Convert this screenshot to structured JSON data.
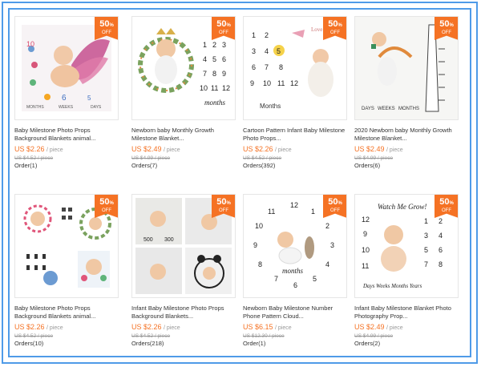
{
  "badge": {
    "pct": "50",
    "pct_sign": "%",
    "off": "OFF"
  },
  "products": [
    {
      "title": "Baby Milestone Photo Props Background Blankets animal...",
      "price": "US $2.26",
      "unit": "/ piece",
      "old_price": "US $4.52 / piece",
      "orders": "Order(1)"
    },
    {
      "title": "Newborn baby Monthly Growth Milestone Blanket...",
      "price": "US $2.49",
      "unit": "/ piece",
      "old_price": "US $4.99 / piece",
      "orders": "Orders(7)"
    },
    {
      "title": "Cartoon Pattern Infant Baby Milestone Photo Props...",
      "price": "US $2.26",
      "unit": "/ piece",
      "old_price": "US $4.52 / piece",
      "orders": "Orders(392)"
    },
    {
      "title": "2020 Newborn baby Monthly Growth Milestone Blanket...",
      "price": "US $2.49",
      "unit": "/ piece",
      "old_price": "US $4.99 / piece",
      "orders": "Orders(6)"
    },
    {
      "title": "Baby Milestone Photo Props Background Blankets animal...",
      "price": "US $2.26",
      "unit": "/ piece",
      "old_price": "US $4.52 / piece",
      "orders": "Orders(10)"
    },
    {
      "title": "Infant Baby Milestone Photo Props Background Blankets...",
      "price": "US $2.26",
      "unit": "/ piece",
      "old_price": "US $4.52 / piece",
      "orders": "Orders(218)"
    },
    {
      "title": "Newborn Baby Milestone Number Phone Pattern Cloud...",
      "price": "US $6.15",
      "unit": "/ piece",
      "old_price": "US $12.30 / piece",
      "orders": "Order(1)"
    },
    {
      "title": "Infant Baby Milestone Blanket Photo Photography Prop...",
      "price": "US $2.49",
      "unit": "/ piece",
      "old_price": "US $4.99 / piece",
      "orders": "Orders(2)"
    }
  ],
  "image_text": {
    "p1": {
      "words": [
        "MONTHS",
        "WEEKS",
        "DAYS"
      ]
    },
    "p2": {
      "nums": [
        "1",
        "2",
        "3",
        "4",
        "5",
        "6",
        "7",
        "8",
        "9",
        "10",
        "11",
        "12"
      ],
      "word": "months"
    },
    "p3": {
      "nums": [
        "1",
        "2",
        "3",
        "4",
        "5",
        "6",
        "7",
        "8",
        "9",
        "10",
        "11",
        "12"
      ],
      "word": "Months",
      "tag": "Love"
    },
    "p4": {
      "words": [
        "DAYS",
        "WEEKS",
        "MONTHS"
      ]
    },
    "p6": {
      "nums": [
        "500",
        "300"
      ]
    },
    "p7": {
      "nums": [
        "1",
        "2",
        "3",
        "4",
        "5",
        "6",
        "7",
        "8",
        "9",
        "10",
        "11",
        "12"
      ],
      "word": "months"
    },
    "p8": {
      "heading": "Watch Me Grow!",
      "nums": [
        "1",
        "2",
        "3",
        "4",
        "5",
        "6",
        "7",
        "8",
        "9",
        "10",
        "11",
        "12"
      ],
      "footer": "Days Weeks Months Years"
    }
  },
  "colors": {
    "accent": "#f57224",
    "frame": "#4f9be8"
  }
}
